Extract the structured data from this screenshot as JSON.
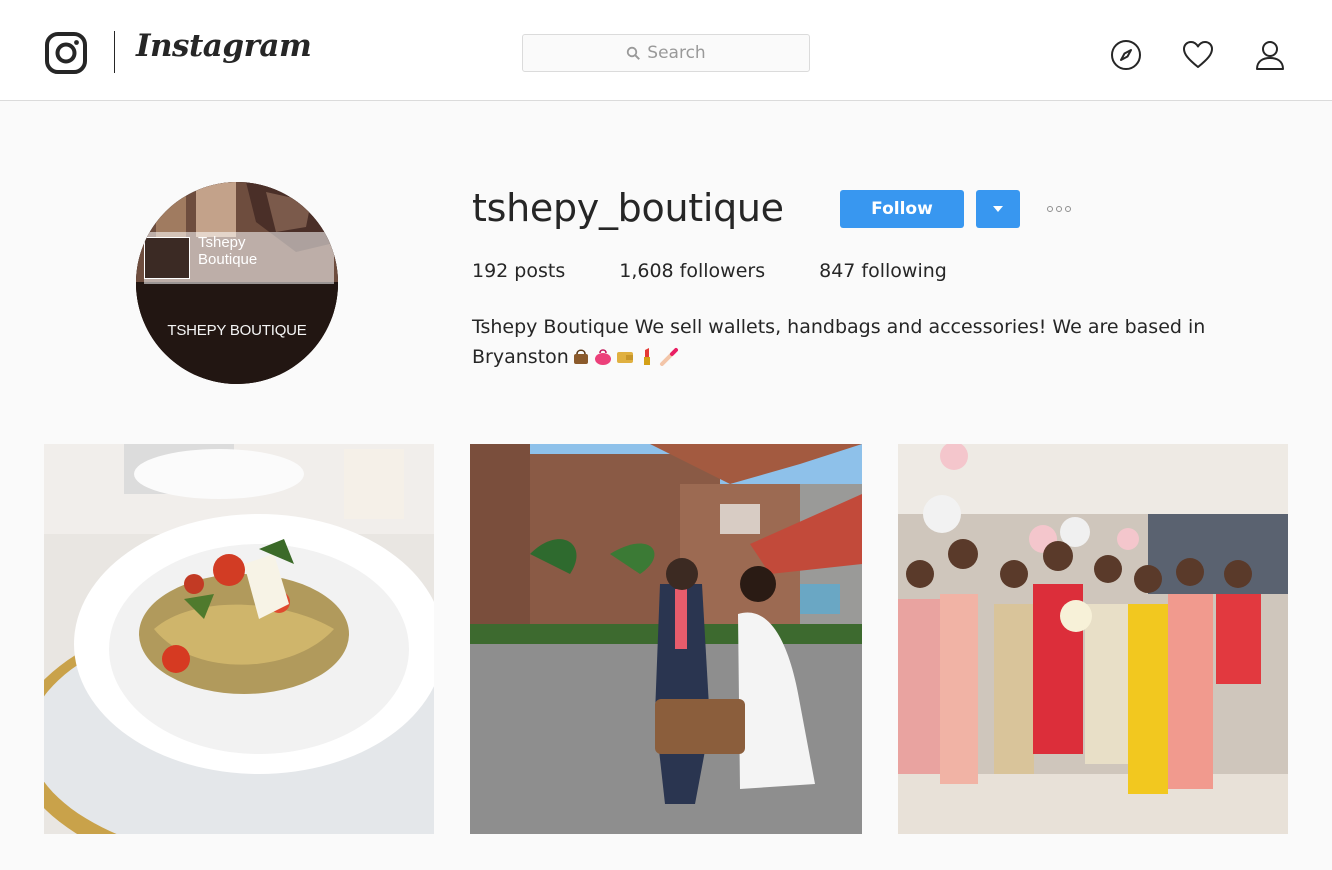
{
  "nav": {
    "brand": "Instagram",
    "search_placeholder": "Search",
    "icons": [
      "instagram-logo-icon",
      "search-icon",
      "explore-compass-icon",
      "activity-heart-icon",
      "profile-person-icon"
    ]
  },
  "profile": {
    "username": "tshepy_boutique",
    "follow_label": "Follow",
    "stats": {
      "posts": "192 posts",
      "followers": "1,608 followers",
      "following": "847 following"
    },
    "bio_name": "Tshepy Boutique",
    "bio_text": "We sell wallets, handbags and accessories! We are based in Bryanston",
    "bio_emojis": [
      "handbag",
      "purse",
      "wallet",
      "lipstick",
      "nail-polish"
    ],
    "avatar": {
      "card_title": "Tshepy\nBoutique",
      "label": "TSHEPY BOUTIQUE"
    }
  },
  "posts": [
    {
      "subject": "pasta-dish-on-gold-charger"
    },
    {
      "subject": "couple-with-leather-bag-outside-building"
    },
    {
      "subject": "group-of-women-at-event-with-balloons"
    }
  ],
  "colors": {
    "accent": "#3897f0",
    "text": "#262626",
    "border": "#dbdbdb",
    "background": "#fafafa"
  }
}
